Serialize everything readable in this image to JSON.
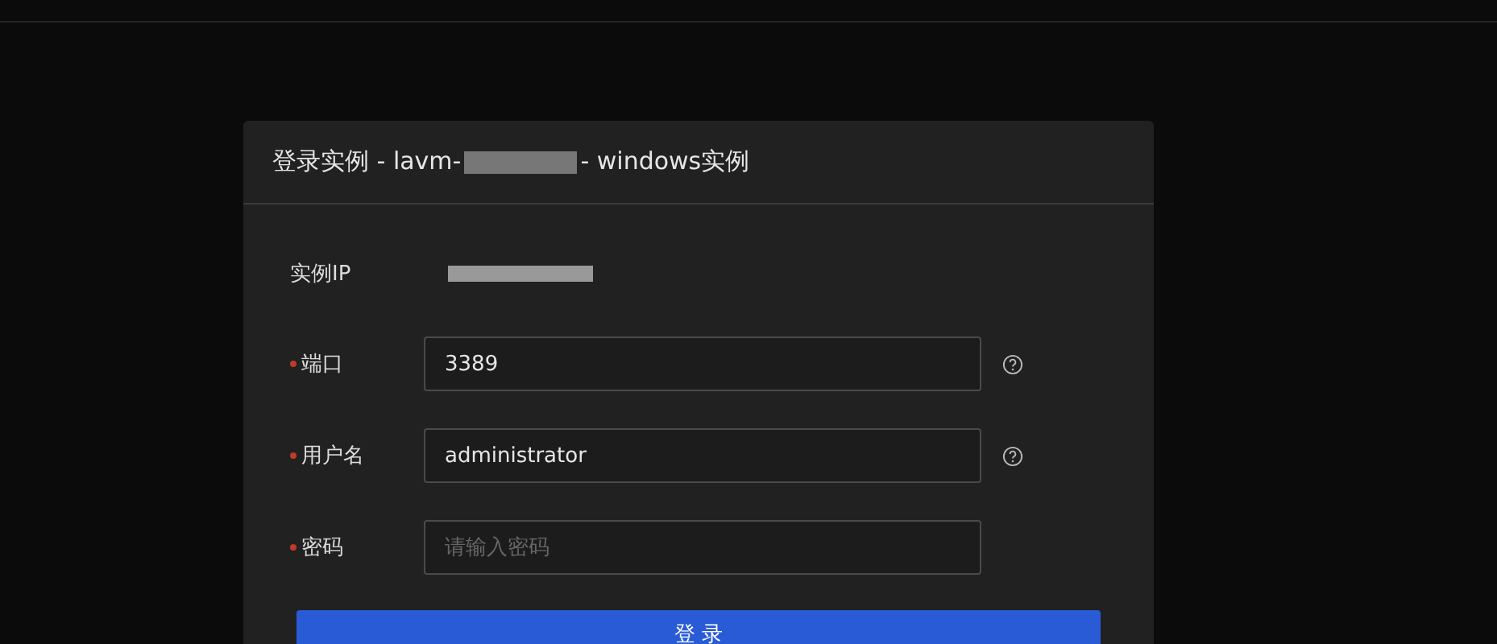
{
  "dialog": {
    "title_start": "登录实例 - lavm-",
    "title_end": "- windows实例"
  },
  "instance_ip": {
    "label": "实例IP"
  },
  "fields": [
    {
      "label": "端口",
      "required": true,
      "value": "3389",
      "help": true
    },
    {
      "label": "用户名",
      "required": true,
      "value": "administrator",
      "help": true
    },
    {
      "label": "密码",
      "required": true,
      "placeholder": "请输入密码",
      "help": false
    }
  ],
  "submit": {
    "label": "登 录"
  }
}
